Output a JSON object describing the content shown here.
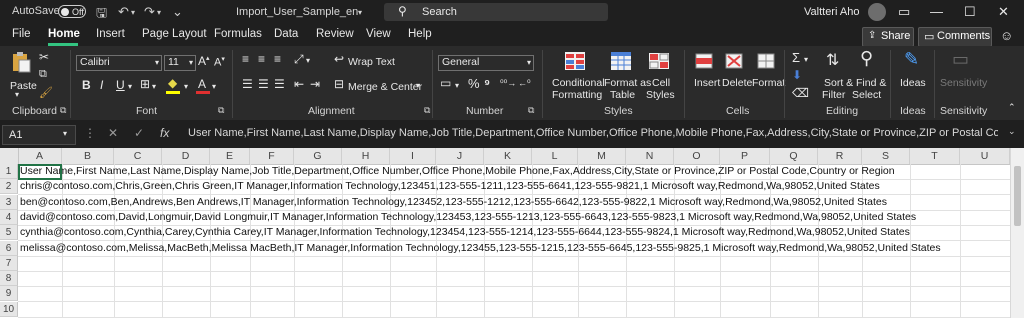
{
  "titlebar": {
    "autosave_label": "AutoSave",
    "autosave_state": "Off",
    "doc_title": "Import_User_Sample_en",
    "search_label": "Search",
    "user_name": "Valtteri Aho"
  },
  "menu": {
    "items": [
      "File",
      "Home",
      "Insert",
      "Page Layout",
      "Formulas",
      "Data",
      "Review",
      "View",
      "Help"
    ],
    "active": "Home",
    "share_label": "Share",
    "comments_label": "Comments"
  },
  "ribbon": {
    "clipboard": {
      "paste": "Paste",
      "label": "Clipboard"
    },
    "font": {
      "name": "Calibri",
      "size": "11",
      "label": "Font"
    },
    "alignment": {
      "wrap": "Wrap Text",
      "merge": "Merge & Center",
      "label": "Alignment"
    },
    "number": {
      "format": "General",
      "label": "Number"
    },
    "styles": {
      "cond1": "Conditional",
      "cond2": "Formatting",
      "fmt1": "Format as",
      "fmt2": "Table",
      "cell1": "Cell",
      "cell2": "Styles",
      "label": "Styles"
    },
    "cells": {
      "insert": "Insert",
      "delete": "Delete",
      "format": "Format",
      "label": "Cells"
    },
    "editing": {
      "sort1": "Sort &",
      "sort2": "Filter",
      "find1": "Find &",
      "find2": "Select",
      "label": "Editing"
    },
    "ideas": {
      "btn": "Ideas",
      "label": "Ideas"
    },
    "sensitivity": {
      "btn": "Sensitivity",
      "label": "Sensitivity"
    },
    "accent": "#33c481"
  },
  "formula_bar": {
    "name_box": "A1",
    "fx": "fx",
    "content": "User Name,First Name,Last Name,Display Name,Job Title,Department,Office Number,Office Phone,Mobile Phone,Fax,Address,City,State or Province,ZIP or Postal Code,Country or"
  },
  "columns": [
    "A",
    "B",
    "C",
    "D",
    "E",
    "F",
    "G",
    "H",
    "I",
    "J",
    "K",
    "L",
    "M",
    "N",
    "O",
    "P",
    "Q",
    "R",
    "S",
    "T",
    "U"
  ],
  "rows": [
    "1",
    "2",
    "3",
    "4",
    "5",
    "6",
    "7",
    "8",
    "9",
    "10"
  ],
  "cells": [
    "User Name,First Name,Last Name,Display Name,Job Title,Department,Office Number,Office Phone,Mobile Phone,Fax,Address,City,State or Province,ZIP or Postal Code,Country or Region",
    "chris@contoso.com,Chris,Green,Chris Green,IT Manager,Information Technology,123451,123-555-1211,123-555-6641,123-555-9821,1 Microsoft way,Redmond,Wa,98052,United States",
    "ben@contoso.com,Ben,Andrews,Ben Andrews,IT Manager,Information Technology,123452,123-555-1212,123-555-6642,123-555-9822,1 Microsoft way,Redmond,Wa,98052,United States",
    "david@contoso.com,David,Longmuir,David Longmuir,IT Manager,Information Technology,123453,123-555-1213,123-555-6643,123-555-9823,1 Microsoft way,Redmond,Wa,98052,United States",
    "cynthia@contoso.com,Cynthia,Carey,Cynthia Carey,IT Manager,Information Technology,123454,123-555-1214,123-555-6644,123-555-9824,1 Microsoft way,Redmond,Wa,98052,United States",
    "melissa@contoso.com,Melissa,MacBeth,Melissa MacBeth,IT Manager,Information Technology,123455,123-555-1215,123-555-6645,123-555-9825,1 Microsoft way,Redmond,Wa,98052,United States"
  ]
}
